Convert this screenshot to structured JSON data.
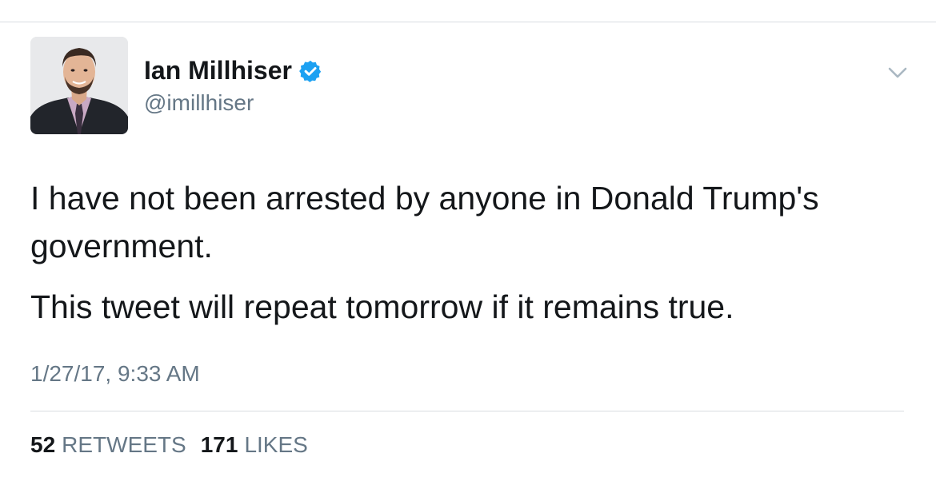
{
  "tweet": {
    "author": {
      "name": "Ian Millhiser",
      "handle": "@imillhiser",
      "verified": true,
      "avatar_icon": "profile-photo"
    },
    "menu_icon": "chevron-down-icon",
    "text": [
      "I have not been arrested by anyone in Donald Trump's government.",
      "This tweet will repeat tomorrow if it remains true."
    ],
    "timestamp": "1/27/17, 9:33 AM",
    "stats": {
      "retweets_count": "52",
      "retweets_label": "RETWEETS",
      "likes_count": "171",
      "likes_label": "LIKES"
    }
  },
  "colors": {
    "text_primary": "#14171a",
    "text_secondary": "#657786",
    "verified_blue": "#1da1f2",
    "divider": "#d9dde1"
  }
}
